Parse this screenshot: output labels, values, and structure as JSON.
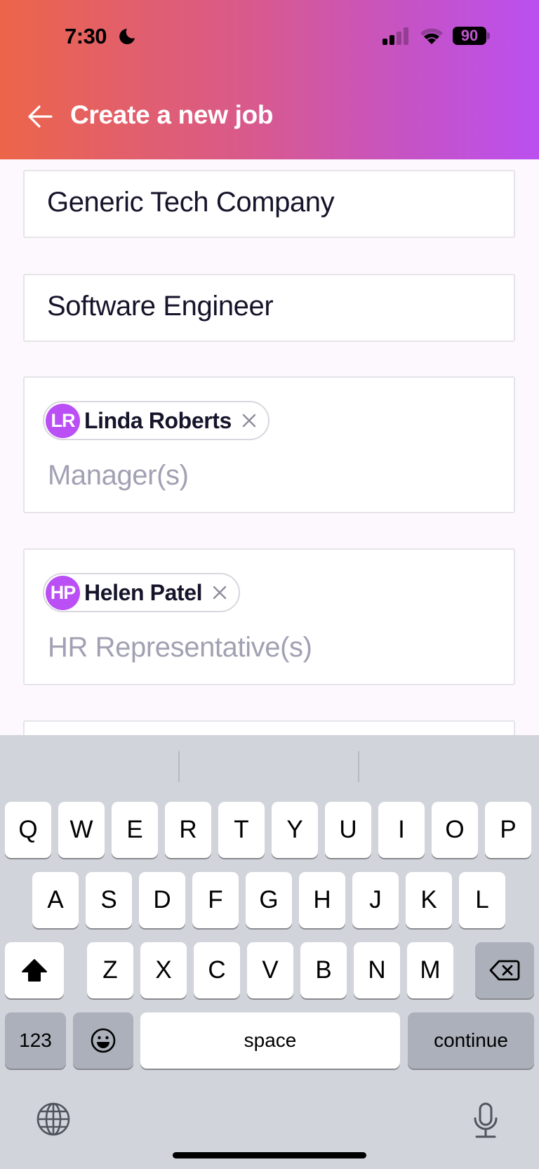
{
  "status_bar": {
    "time": "7:30",
    "battery": "90",
    "icons": [
      "moon-icon",
      "signal-icon",
      "wifi-icon",
      "battery-icon"
    ]
  },
  "header": {
    "title": "Create a new job",
    "back_icon": "arrow-left-icon",
    "gradient": [
      "#ec6549",
      "#bb50f0"
    ]
  },
  "form": {
    "company": {
      "value": "Generic Tech Company"
    },
    "job_title": {
      "value": "Software Engineer"
    },
    "managers": {
      "placeholder": "Manager(s)",
      "chips": [
        {
          "initials": "LR",
          "name": "Linda Roberts"
        }
      ]
    },
    "hr_reps": {
      "placeholder": "HR Representative(s)",
      "chips": [
        {
          "initials": "HP",
          "name": "Helen Patel"
        }
      ]
    },
    "accent": "#b94ff4"
  },
  "keyboard": {
    "row1": [
      "Q",
      "W",
      "E",
      "R",
      "T",
      "Y",
      "U",
      "I",
      "O",
      "P"
    ],
    "row2": [
      "A",
      "S",
      "D",
      "F",
      "G",
      "H",
      "J",
      "K",
      "L"
    ],
    "row3": [
      "Z",
      "X",
      "C",
      "V",
      "B",
      "N",
      "M"
    ],
    "numbers_label": "123",
    "space_label": "space",
    "return_label": "continue"
  }
}
